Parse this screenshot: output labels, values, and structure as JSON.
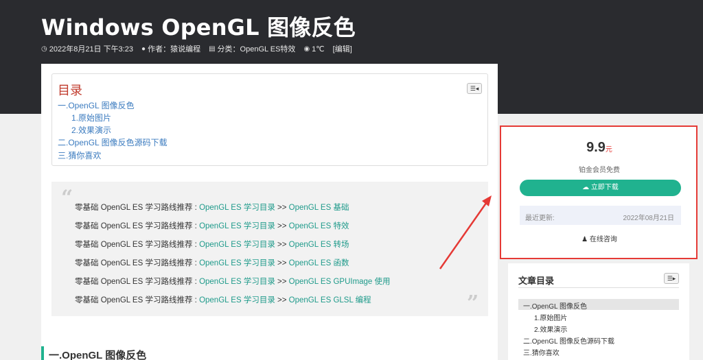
{
  "post": {
    "title": "Windows OpenGL 图像反色",
    "meta": {
      "date": "2022年8月21日 下午3:23",
      "author": "作者：猿说编程",
      "category": "分类：OpenGL ES特效",
      "views": "1℃",
      "edit": "[编辑]"
    }
  },
  "toc": {
    "title": "目录",
    "items": [
      "一.OpenGL 图像反色",
      "1.原始图片",
      "2.效果演示",
      "二.OpenGL 图像反色源码下载",
      "三.猜你喜欢"
    ]
  },
  "quote": {
    "prefix": "零基础 OpenGL ES 学习路线推荐 : ",
    "lines": [
      {
        "link1": "OpenGL ES 学习目录",
        "sep": " >> ",
        "link2": "OpenGL ES 基础"
      },
      {
        "link1": "OpenGL ES 学习目录",
        "sep": " >> ",
        "link2": "OpenGL ES 特效"
      },
      {
        "link1": "OpenGL ES 学习目录",
        "sep": " >> ",
        "link2": "OpenGL ES 转场"
      },
      {
        "link1": "OpenGL ES 学习目录",
        "sep": " >> ",
        "link2": "OpenGL ES 函数"
      },
      {
        "link1": "OpenGL ES 学习目录",
        "sep": " >> ",
        "link2": "OpenGL ES GPUImage 使用"
      },
      {
        "link1": "OpenGL ES 学习目录",
        "sep": " >> ",
        "link2": "OpenGL ES GLSL 编程"
      }
    ]
  },
  "section_heading": "一.OpenGL 图像反色",
  "download": {
    "price": "9.9",
    "currency": "元",
    "free_note": "铂金会员免费",
    "button": "立即下载",
    "updated_label": "最近更新:",
    "updated_date": "2022年08月21日",
    "consult": "在线咨询"
  },
  "side_toc": {
    "title": "文章目录",
    "items": [
      "一.OpenGL 图像反色",
      "1.原始图片",
      "2.效果演示",
      "二.OpenGL 图像反色源码下载",
      "三.猜你喜欢"
    ]
  },
  "colors": {
    "accent": "#20b28f",
    "highlight_border": "#e53935",
    "header_bg": "#2a2b2f"
  }
}
